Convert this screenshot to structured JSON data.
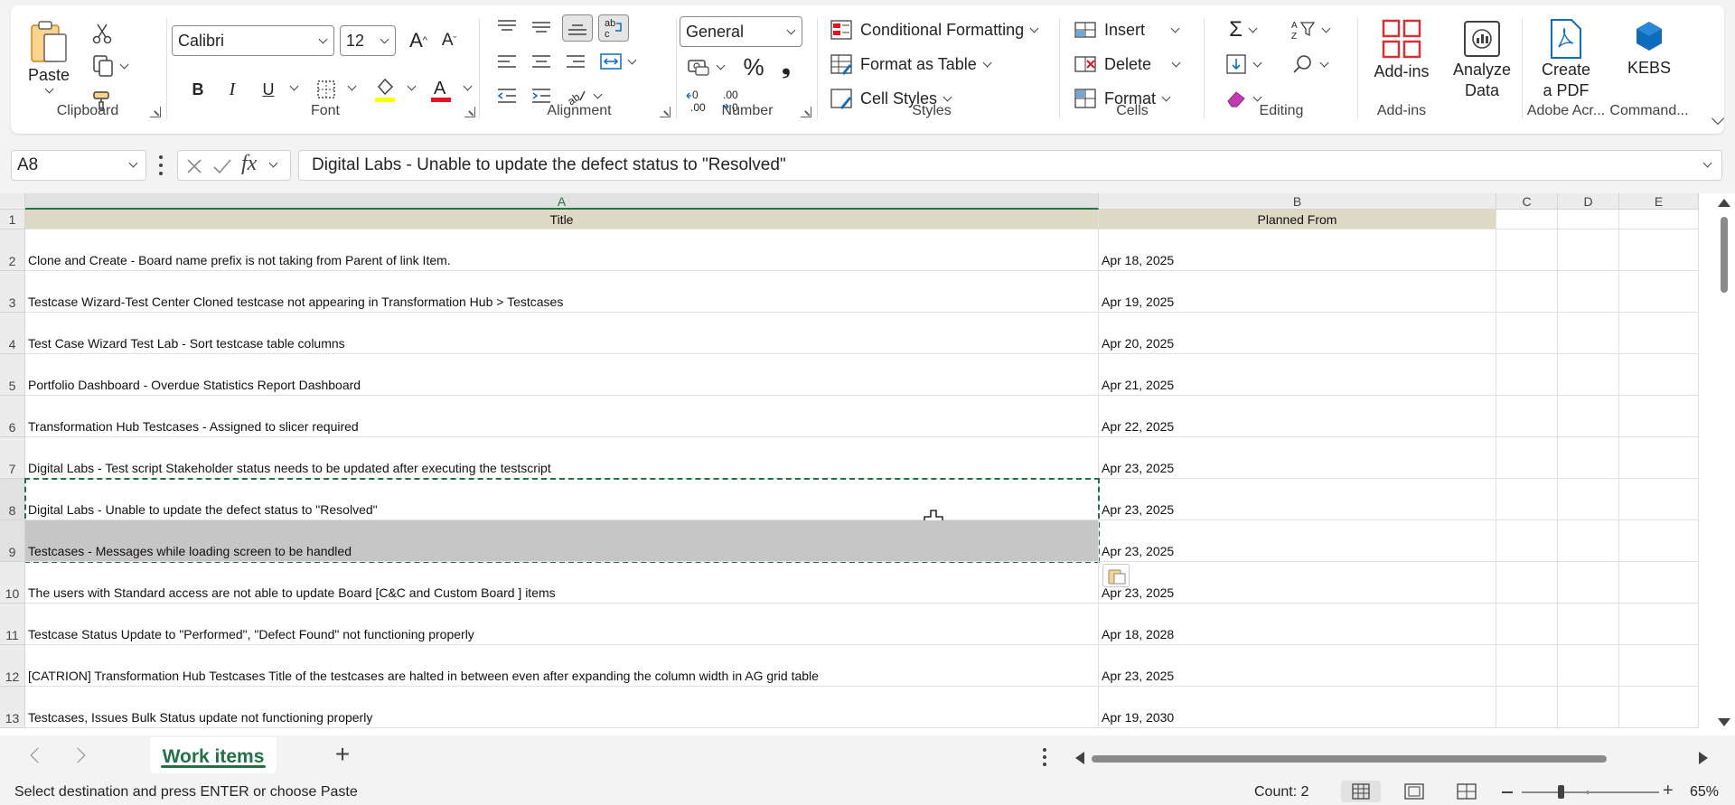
{
  "ribbon": {
    "clipboard": {
      "paste_label": "Paste",
      "group_label": "Clipboard"
    },
    "font": {
      "font_name": "Calibri",
      "font_size": "12",
      "group_label": "Font",
      "bold": "B",
      "italic": "I",
      "underline": "U"
    },
    "alignment": {
      "group_label": "Alignment"
    },
    "number": {
      "format": "General",
      "percent": "%",
      "comma": "❟",
      "inc_dec": "←0 .00",
      "dec_dec": ".00 →0",
      "group_label": "Number"
    },
    "styles": {
      "conditional_formatting": "Conditional Formatting",
      "format_as_table": "Format as Table",
      "cell_styles": "Cell Styles",
      "group_label": "Styles"
    },
    "cells": {
      "insert": "Insert",
      "delete": "Delete",
      "format": "Format",
      "group_label": "Cells"
    },
    "editing": {
      "group_label": "Editing"
    },
    "addins": {
      "addins_label": "Add-ins",
      "group_label": "Add-ins"
    },
    "analyze": {
      "label_line1": "Analyze",
      "label_line2": "Data"
    },
    "adobe": {
      "label_line1": "Create",
      "label_line2": "a PDF",
      "group_label": "Adobe Acr..."
    },
    "kebs": {
      "label": "KEBS",
      "group_label": "Command..."
    }
  },
  "formula_bar": {
    "name_box": "A8",
    "formula": "Digital Labs - Unable to update the defect status to \"Resolved\""
  },
  "grid": {
    "columns": [
      "A",
      "B",
      "C",
      "D",
      "E"
    ],
    "header_row": {
      "row": "1",
      "title": "Title",
      "planned_from": "Planned From"
    },
    "rows": [
      {
        "num": "2",
        "title": "Clone and Create - Board name prefix is not taking from Parent of link Item.",
        "date": "Apr 18, 2025"
      },
      {
        "num": "3",
        "title": "Testcase Wizard-Test Center Cloned testcase not appearing in Transformation Hub > Testcases",
        "date": "Apr 19, 2025"
      },
      {
        "num": "4",
        "title": "Test Case Wizard Test Lab - Sort testcase table columns",
        "date": "Apr 20, 2025"
      },
      {
        "num": "5",
        "title": "Portfolio Dashboard - Overdue Statistics Report Dashboard",
        "date": "Apr 21, 2025"
      },
      {
        "num": "6",
        "title": "Transformation Hub Testcases - Assigned to slicer required",
        "date": "Apr 22, 2025"
      },
      {
        "num": "7",
        "title": "Digital Labs - Test script Stakeholder status needs to be updated after executing the testscript",
        "date": "Apr 23, 2025"
      },
      {
        "num": "8",
        "title": "Digital Labs - Unable to update the defect status to \"Resolved\"",
        "date": "Apr 23, 2025"
      },
      {
        "num": "9",
        "title": "Testcases - Messages while loading screen to be handled",
        "date": "Apr 23, 2025"
      },
      {
        "num": "10",
        "title": "The users with Standard access are not able to update Board [C&C and Custom Board ] items",
        "date": "Apr 23, 2025"
      },
      {
        "num": "11",
        "title": "Testcase Status Update to \"Performed\", \"Defect Found\" not functioning properly",
        "date": "Apr 18, 2028"
      },
      {
        "num": "12",
        "title": "[CATRION] Transformation Hub Testcases Title of the testcases are halted in between even after expanding the column width in AG grid table",
        "date": "Apr 23, 2025"
      },
      {
        "num": "13",
        "title": "Testcases, Issues Bulk Status update not functioning properly",
        "date": "Apr 19, 2030"
      }
    ]
  },
  "sheets": {
    "active": "Work items",
    "add": "+"
  },
  "status": {
    "message": "Select destination and press ENTER or choose Paste",
    "count": "Count: 2",
    "zoom": "65%"
  },
  "colors": {
    "accent": "#217346",
    "header_fill": "#ddd9c4",
    "selection": "#c6c6c6"
  }
}
